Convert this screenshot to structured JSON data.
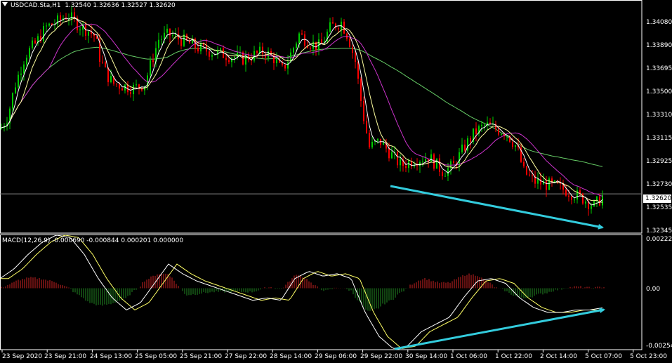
{
  "header": {
    "symbol_label": "USDCAD.Sta,H1",
    "ohlc": "1.32540 1.32636 1.32527 1.32620"
  },
  "macd": {
    "label": "MACD(12,26,9) -0.000690 -0.000844 0.000201 0.000000",
    "axis_labels": [
      "0.002224",
      "0.00",
      "-0.002544"
    ]
  },
  "price_axis": {
    "labels": [
      "1.34080",
      "1.33890",
      "1.33695",
      "1.33500",
      "1.33310",
      "1.33115",
      "1.32925",
      "1.32730",
      "1.32535",
      "1.32345"
    ],
    "current_price": "1.32620"
  },
  "time_axis": {
    "labels": [
      "23 Sep 2020",
      "23 Sep 21:00",
      "24 Sep 13:00",
      "25 Sep 05:00",
      "25 Sep 21:00",
      "27 Sep 22:00",
      "28 Sep 14:00",
      "29 Sep 06:00",
      "29 Sep 22:00",
      "30 Sep 14:00",
      "1 Oct 06:00",
      "1 Oct 22:00",
      "2 Oct 14:00",
      "5 Oct 07:00",
      "5 Oct 23:00"
    ]
  },
  "colors": {
    "bull": "#00cc00",
    "bear": "#ff0000",
    "ma_fast": "#ffffa0",
    "ma_mid": "#ffffff",
    "ma_slow": "#cc33cc",
    "ma_long": "#66cc66",
    "annotation": "#33ccdd",
    "macd_hist_pos": "#cc2222",
    "macd_hist_neg": "#228822",
    "macd_signal": "#ffff66",
    "macd_main": "#ffffff"
  },
  "chart_data": {
    "type": "candlestick",
    "symbol": "USDCAD.Sta",
    "timeframe": "H1",
    "price_close_path": [
      [
        0,
        1.3315
      ],
      [
        10,
        1.3325
      ],
      [
        20,
        1.335
      ],
      [
        35,
        1.3375
      ],
      [
        50,
        1.3385
      ],
      [
        65,
        1.3398
      ],
      [
        80,
        1.3402
      ],
      [
        95,
        1.3408
      ],
      [
        110,
        1.34
      ],
      [
        125,
        1.3395
      ],
      [
        135,
        1.339
      ],
      [
        140,
        1.3375
      ],
      [
        150,
        1.336
      ],
      [
        160,
        1.3352
      ],
      [
        175,
        1.335
      ],
      [
        190,
        1.3348
      ],
      [
        205,
        1.3352
      ],
      [
        215,
        1.337
      ],
      [
        225,
        1.3388
      ],
      [
        240,
        1.3392
      ],
      [
        255,
        1.3388
      ],
      [
        270,
        1.3384
      ],
      [
        285,
        1.338
      ],
      [
        300,
        1.3378
      ],
      [
        315,
        1.3376
      ],
      [
        330,
        1.3374
      ],
      [
        345,
        1.3372
      ],
      [
        360,
        1.3375
      ],
      [
        375,
        1.3378
      ],
      [
        390,
        1.3372
      ],
      [
        400,
        1.3362
      ],
      [
        410,
        1.3372
      ],
      [
        425,
        1.3392
      ],
      [
        440,
        1.3385
      ],
      [
        455,
        1.3382
      ],
      [
        470,
        1.3398
      ],
      [
        485,
        1.3402
      ],
      [
        495,
        1.339
      ],
      [
        505,
        1.337
      ],
      [
        515,
        1.333
      ],
      [
        525,
        1.33
      ],
      [
        540,
        1.3305
      ],
      [
        555,
        1.3295
      ],
      [
        570,
        1.3285
      ],
      [
        590,
        1.329
      ],
      [
        610,
        1.3292
      ],
      [
        630,
        1.328
      ],
      [
        645,
        1.3285
      ],
      [
        660,
        1.33
      ],
      [
        675,
        1.3312
      ],
      [
        690,
        1.3318
      ],
      [
        705,
        1.3315
      ],
      [
        720,
        1.3312
      ],
      [
        735,
        1.33
      ],
      [
        745,
        1.328
      ],
      [
        760,
        1.3272
      ],
      [
        775,
        1.327
      ],
      [
        790,
        1.3268
      ],
      [
        805,
        1.3265
      ],
      [
        815,
        1.3262
      ],
      [
        830,
        1.3258
      ],
      [
        845,
        1.3252
      ],
      [
        860,
        1.3262
      ]
    ],
    "macd_path": [
      [
        0,
        0.0004
      ],
      [
        20,
        0.0008
      ],
      [
        40,
        0.0014
      ],
      [
        60,
        0.0019
      ],
      [
        80,
        0.0022
      ],
      [
        100,
        0.0021
      ],
      [
        120,
        0.0014
      ],
      [
        140,
        0.0004
      ],
      [
        160,
        -0.0004
      ],
      [
        180,
        -0.0009
      ],
      [
        200,
        -0.0006
      ],
      [
        220,
        0.0002
      ],
      [
        240,
        0.001
      ],
      [
        260,
        0.0006
      ],
      [
        280,
        0.0003
      ],
      [
        300,
        0.0001
      ],
      [
        320,
        -0.0001
      ],
      [
        340,
        -0.0003
      ],
      [
        360,
        -0.0005
      ],
      [
        380,
        -0.0004
      ],
      [
        400,
        -0.0005
      ],
      [
        420,
        0.0004
      ],
      [
        440,
        0.0007
      ],
      [
        460,
        0.0005
      ],
      [
        480,
        0.0006
      ],
      [
        500,
        0.0004
      ],
      [
        520,
        -0.001
      ],
      [
        540,
        -0.002
      ],
      [
        560,
        -0.0025
      ],
      [
        580,
        -0.0024
      ],
      [
        600,
        -0.0018
      ],
      [
        620,
        -0.0015
      ],
      [
        640,
        -0.0012
      ],
      [
        660,
        -0.0004
      ],
      [
        680,
        0.0003
      ],
      [
        700,
        0.0004
      ],
      [
        720,
        0.0002
      ],
      [
        740,
        -0.0004
      ],
      [
        760,
        -0.0008
      ],
      [
        780,
        -0.001
      ],
      [
        800,
        -0.001
      ],
      [
        820,
        -0.0009
      ],
      [
        840,
        -0.0009
      ],
      [
        860,
        -0.0008
      ]
    ],
    "current_price": 1.3262,
    "ylim": [
      1.323,
      1.342
    ],
    "macd_ylim": [
      -0.002544,
      0.002224
    ]
  }
}
